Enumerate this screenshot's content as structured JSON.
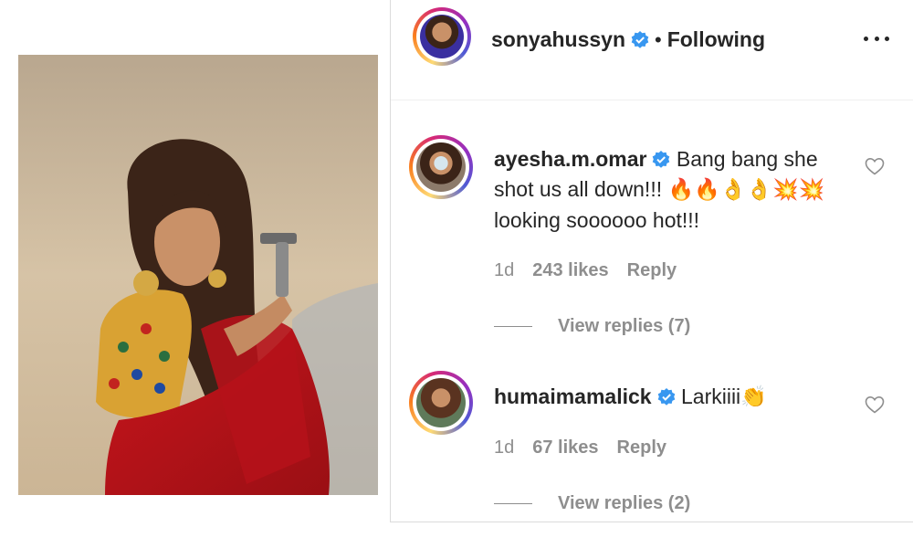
{
  "post": {
    "author": "sonyahussyn",
    "follow_state": "Following",
    "separator": "•"
  },
  "comments": [
    {
      "username": "ayesha.m.omar",
      "text_line1": "Bang bang she",
      "text_line2": "shot us all down!!!",
      "emojis": "🔥🔥👌👌💥💥",
      "text_line3": "looking soooooo hot!!!",
      "age": "1d",
      "likes": "243 likes",
      "reply_label": "Reply",
      "view_replies": "View replies (7)"
    },
    {
      "username": "humaimamalick",
      "text": "Larkiiii",
      "emojis": "👏",
      "age": "1d",
      "likes": "67 likes",
      "reply_label": "Reply",
      "view_replies": "View replies (2)"
    }
  ],
  "colors": {
    "verified": "#3897f0",
    "muted": "#8e8e8e",
    "text": "#262626"
  }
}
